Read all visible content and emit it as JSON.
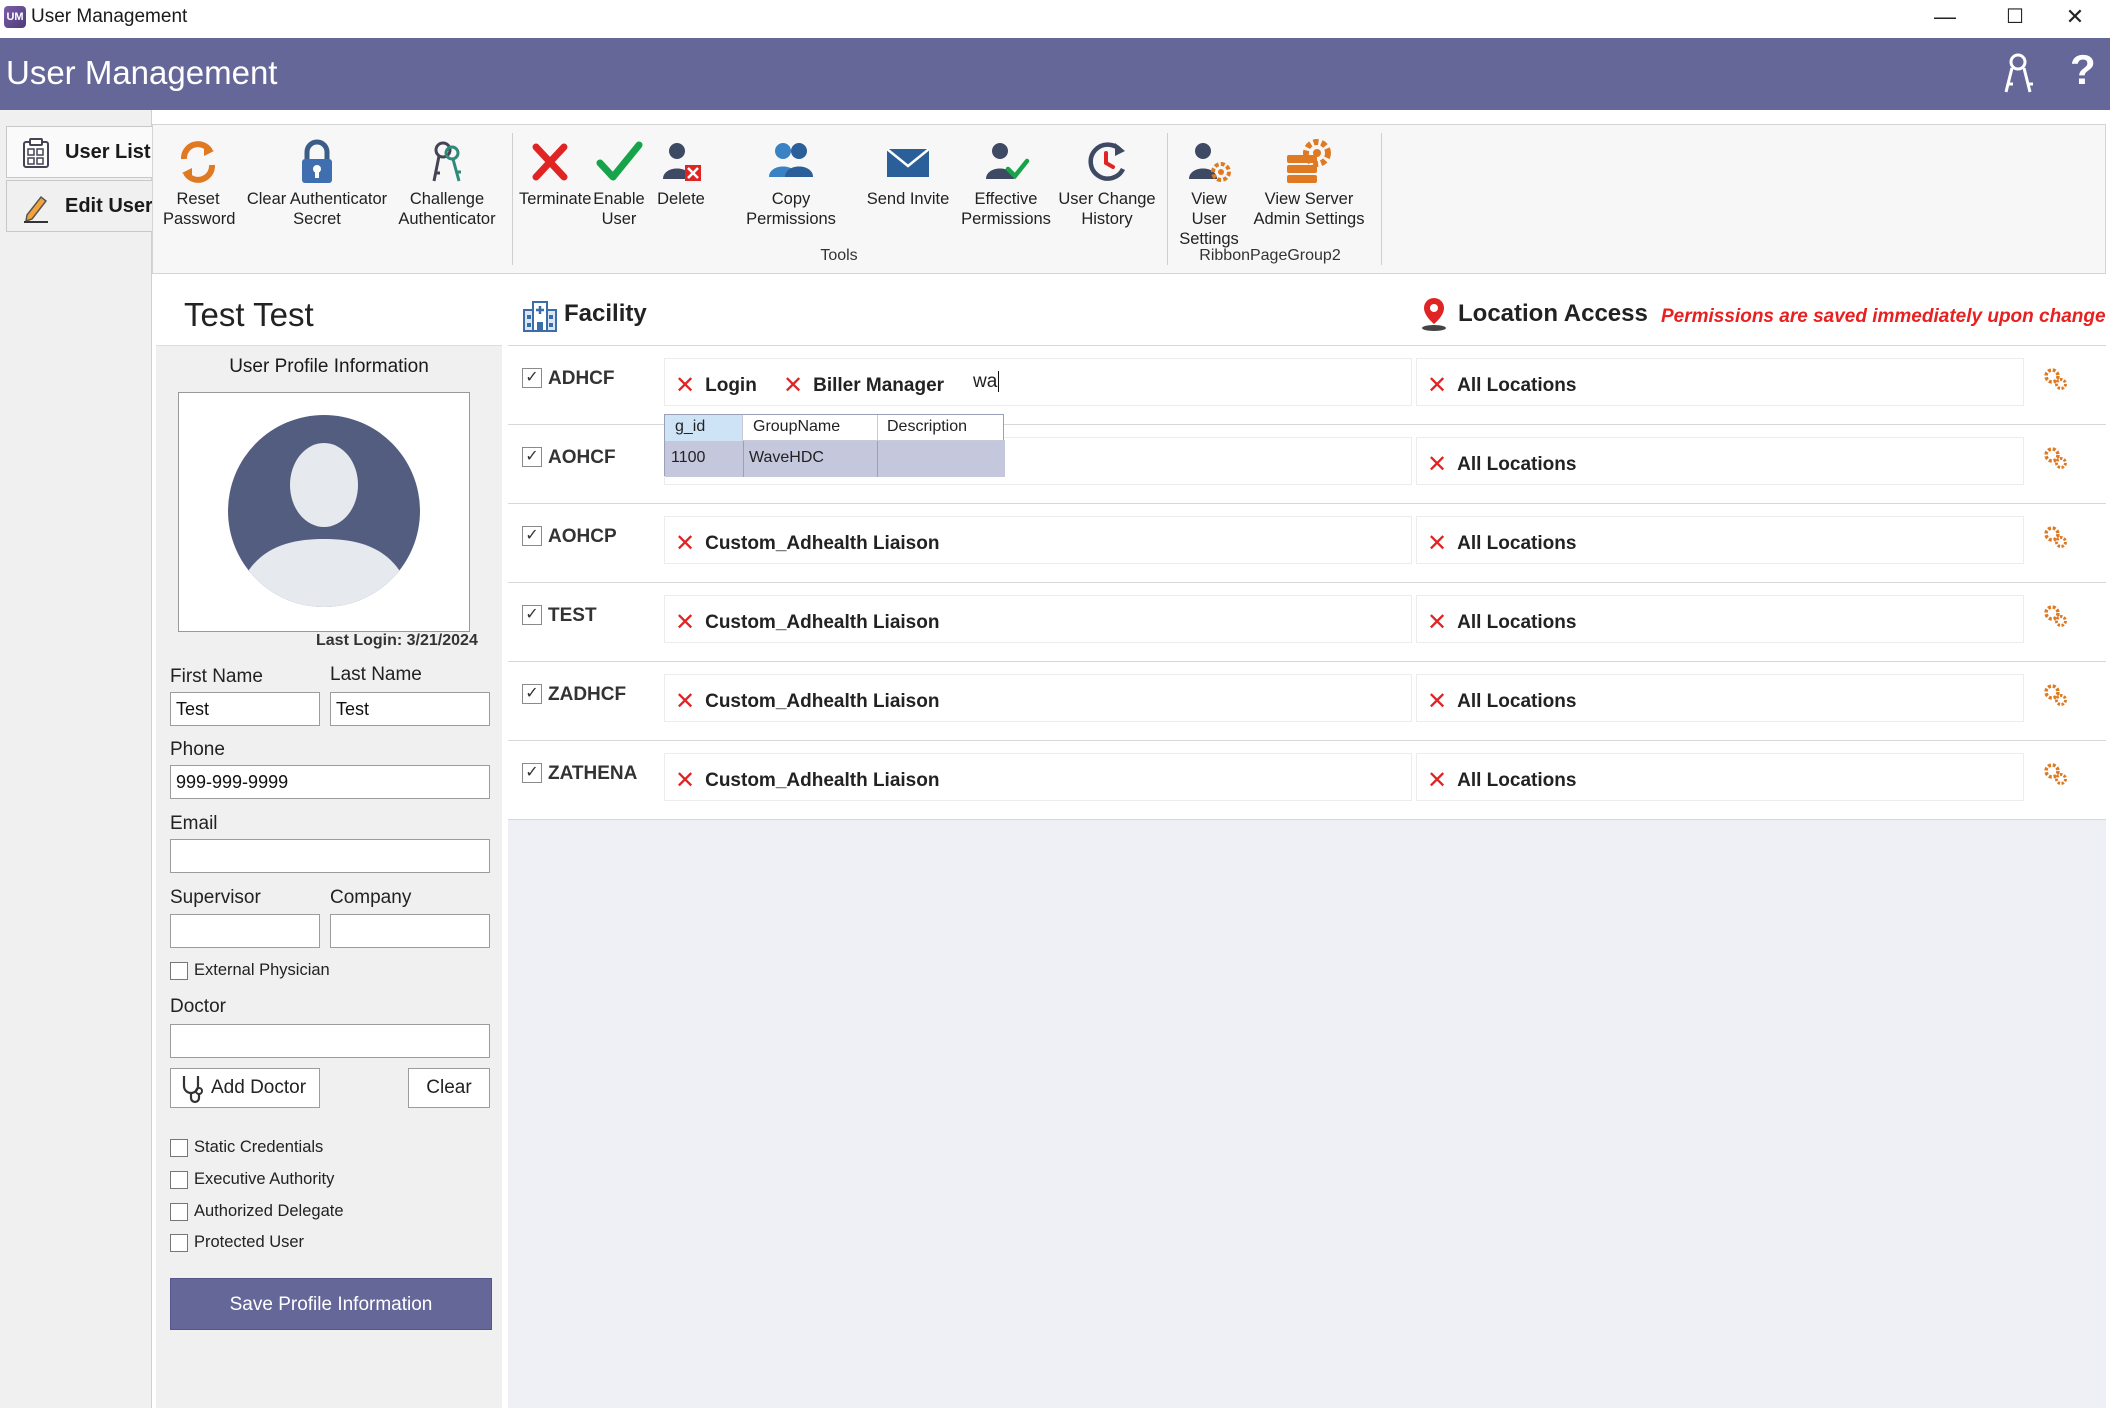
{
  "window": {
    "title": "User Management",
    "controls": {
      "minimize": "—",
      "maximize": "☐",
      "close": "✕"
    }
  },
  "header": {
    "title": "User Management",
    "help_glyph": "?",
    "color": "#666799"
  },
  "tabs": [
    {
      "label": "User List",
      "icon": "user-list-icon"
    },
    {
      "label": "Edit User",
      "icon": "edit-pencil-icon"
    }
  ],
  "ribbon": {
    "group_left_buttons": [
      {
        "line1": "Reset",
        "line2": "Password",
        "icon": "refresh-icon"
      },
      {
        "line1": "Clear Authenticator",
        "line2": "Secret",
        "icon": "padlock-icon"
      },
      {
        "line1": "Challenge",
        "line2": "Authenticator",
        "icon": "keys-icon"
      }
    ],
    "tools_buttons": [
      {
        "line1": "Terminate",
        "line2": "",
        "icon": "x-icon"
      },
      {
        "line1": "Enable",
        "line2": "User",
        "icon": "checkmark-icon"
      },
      {
        "line1": "Delete",
        "line2": "",
        "icon": "delete-user-icon"
      },
      {
        "line1": "Copy Permissions",
        "line2": "",
        "icon": "users-icon"
      },
      {
        "line1": "Send Invite",
        "line2": "",
        "icon": "envelope-icon"
      },
      {
        "line1": "Effective",
        "line2": "Permissions",
        "icon": "user-check-icon"
      },
      {
        "line1": "User Change",
        "line2": "History",
        "icon": "history-icon"
      }
    ],
    "tools_group_label": "Tools",
    "group2_buttons": [
      {
        "line1": "View User",
        "line2": "Settings",
        "icon": "user-settings-icon"
      },
      {
        "line1": "View Server",
        "line2": "Admin Settings",
        "icon": "server-settings-icon"
      }
    ],
    "group2_label": "RibbonPageGroup2"
  },
  "profile": {
    "name": "Test Test",
    "section_title": "User Profile Information",
    "last_login": "Last Login: 3/21/2024",
    "first_name_label": "First Name",
    "first_name": "Test",
    "last_name_label": "Last Name",
    "last_name": "Test",
    "phone_label": "Phone",
    "phone": "999-999-9999",
    "email_label": "Email",
    "email": "",
    "supervisor_label": "Supervisor",
    "supervisor": "",
    "company_label": "Company",
    "company": "",
    "external_physician_label": "External Physician",
    "external_physician": false,
    "doctor_label": "Doctor",
    "doctor": "",
    "add_doctor_label": "Add Doctor",
    "clear_label": "Clear",
    "flags": [
      {
        "label": "Static Credentials",
        "checked": false
      },
      {
        "label": "Executive Authority",
        "checked": false
      },
      {
        "label": "Authorized Delegate",
        "checked": false
      },
      {
        "label": "Protected User",
        "checked": false
      }
    ],
    "save_label": "Save Profile Information"
  },
  "main": {
    "facility_title": "Facility",
    "location_title": "Location Access",
    "permissions_note": "Permissions are saved immediately upon change",
    "rows": [
      {
        "facility": "ADHCF",
        "checked": true,
        "groups": [
          "Login",
          "Biller Manager"
        ],
        "typing": "wa",
        "location": "All Locations"
      },
      {
        "facility": "AOHCF",
        "checked": true,
        "groups": [],
        "typing": "",
        "location": "All Locations"
      },
      {
        "facility": "AOHCP",
        "checked": true,
        "groups": [
          "Custom_Adhealth Liaison"
        ],
        "typing": "",
        "location": "All Locations"
      },
      {
        "facility": "TEST",
        "checked": true,
        "groups": [
          "Custom_Adhealth Liaison"
        ],
        "typing": "",
        "location": "All Locations"
      },
      {
        "facility": "ZADHCF",
        "checked": true,
        "groups": [
          "Custom_Adhealth Liaison"
        ],
        "typing": "",
        "location": "All Locations"
      },
      {
        "facility": "ZATHENA",
        "checked": true,
        "groups": [
          "Custom_Adhealth Liaison"
        ],
        "typing": "",
        "location": "All Locations"
      }
    ],
    "dropdown": {
      "columns": [
        "g_id",
        "GroupName",
        "Description"
      ],
      "rows": [
        {
          "g_id": "1100",
          "GroupName": "WaveHDC",
          "Description": ""
        }
      ]
    }
  }
}
